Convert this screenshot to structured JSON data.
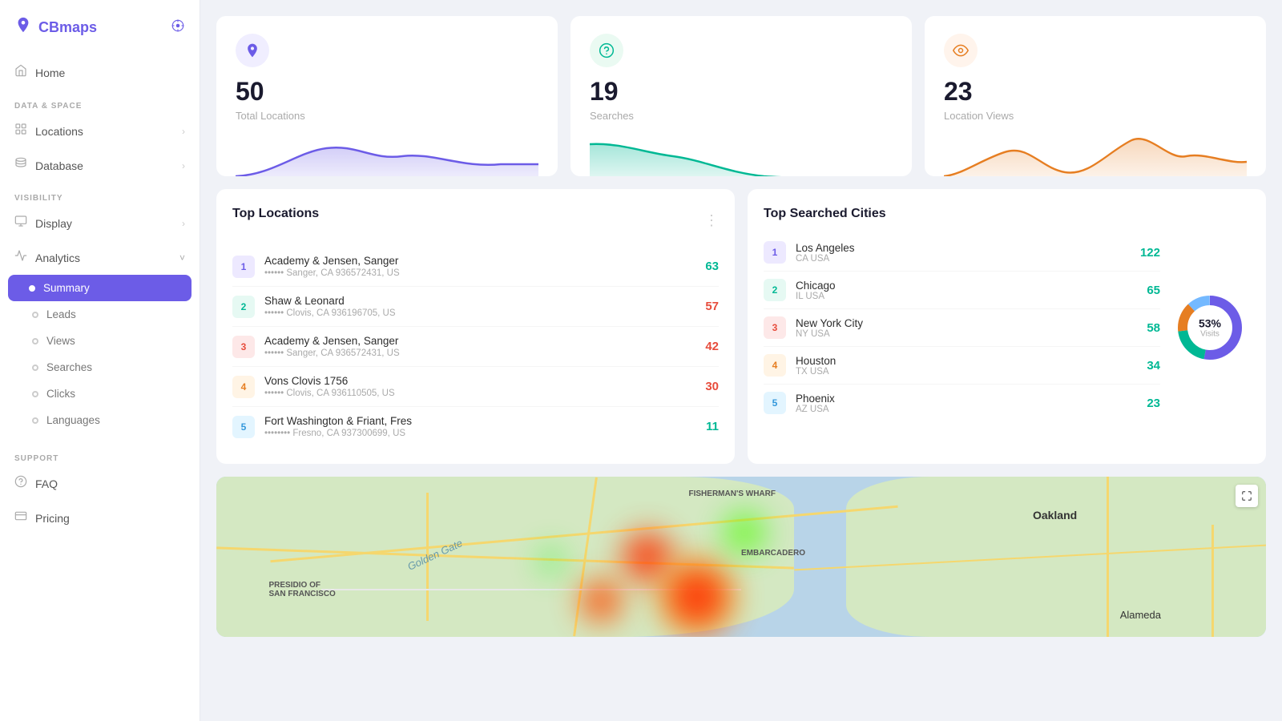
{
  "app": {
    "name": "CBmaps",
    "logo_icon": "📍",
    "pin_icon": "⊙"
  },
  "sidebar": {
    "home_label": "Home",
    "sections": [
      {
        "label": "DATA & SPACE",
        "items": [
          {
            "id": "locations",
            "label": "Locations",
            "has_chevron": true
          },
          {
            "id": "database",
            "label": "Database",
            "has_chevron": true
          }
        ]
      },
      {
        "label": "VISIBILITY",
        "items": [
          {
            "id": "display",
            "label": "Display",
            "has_chevron": true
          },
          {
            "id": "analytics",
            "label": "Analytics",
            "is_parent": true,
            "chevron": "down",
            "children": [
              {
                "id": "summary",
                "label": "Summary",
                "active": true
              },
              {
                "id": "leads",
                "label": "Leads"
              },
              {
                "id": "views",
                "label": "Views"
              },
              {
                "id": "searches",
                "label": "Searches"
              },
              {
                "id": "clicks",
                "label": "Clicks"
              },
              {
                "id": "languages",
                "label": "Languages"
              }
            ]
          }
        ]
      },
      {
        "label": "SUPPORT",
        "items": [
          {
            "id": "faq",
            "label": "FAQ"
          },
          {
            "id": "pricing",
            "label": "Pricing"
          }
        ]
      }
    ]
  },
  "stats": [
    {
      "id": "total-locations",
      "icon": "📍",
      "icon_type": "purple",
      "number": "50",
      "label": "Total Locations",
      "chart_color": "#6c5ce7",
      "chart_fill": "#ede9ff"
    },
    {
      "id": "searches",
      "icon": "?",
      "icon_type": "green",
      "number": "19",
      "label": "Searches",
      "chart_color": "#00b894",
      "chart_fill": "#eafaf2"
    },
    {
      "id": "location-views",
      "icon": "👁",
      "icon_type": "orange",
      "number": "23",
      "label": "Location Views",
      "chart_color": "#e67e22",
      "chart_fill": "#fff4ec"
    }
  ],
  "top_locations": {
    "title": "Top Locations",
    "items": [
      {
        "rank": 1,
        "name": "Academy & Jensen, Sanger",
        "addr": "•••••• Sanger, CA 936572431, US",
        "count": 63,
        "count_color": "green"
      },
      {
        "rank": 2,
        "name": "Shaw & Leonard",
        "addr": "•••••• Clovis, CA 936196705, US",
        "count": 57,
        "count_color": "red"
      },
      {
        "rank": 3,
        "name": "Academy & Jensen, Sanger",
        "addr": "•••••• Sanger, CA 936572431, US",
        "count": 42,
        "count_color": "red"
      },
      {
        "rank": 4,
        "name": "Vons Clovis 1756",
        "addr": "•••••• Clovis, CA 936110505, US",
        "count": 30,
        "count_color": "red"
      },
      {
        "rank": 5,
        "name": "Fort Washington & Friant, Fres",
        "addr": "•••••••• Fresno, CA 937300699, US",
        "count": 11,
        "count_color": "green"
      }
    ]
  },
  "top_cities": {
    "title": "Top Searched Cities",
    "donut": {
      "percent": "53%",
      "label": "Visits"
    },
    "items": [
      {
        "rank": 1,
        "name": "Los Angeles",
        "region": "CA USA",
        "count": 122
      },
      {
        "rank": 2,
        "name": "Chicago",
        "region": "IL USA",
        "count": 65
      },
      {
        "rank": 3,
        "name": "New York City",
        "region": "NY USA",
        "count": 58
      },
      {
        "rank": 4,
        "name": "Houston",
        "region": "TX USA",
        "count": 34
      },
      {
        "rank": 5,
        "name": "Phoenix",
        "region": "AZ USA",
        "count": 23
      }
    ]
  },
  "map": {
    "expand_icon": "⛶",
    "labels": [
      "Golden Gate",
      "FISHERMAN'S WHARF",
      "PRESIDIO OF SAN FRANCISCO",
      "EMBARCADERO",
      "Oakland",
      "Alameda"
    ]
  },
  "colors": {
    "purple": "#6c5ce7",
    "green": "#00b894",
    "orange": "#e67e22",
    "red": "#e74c3c",
    "blue": "#3498db"
  }
}
